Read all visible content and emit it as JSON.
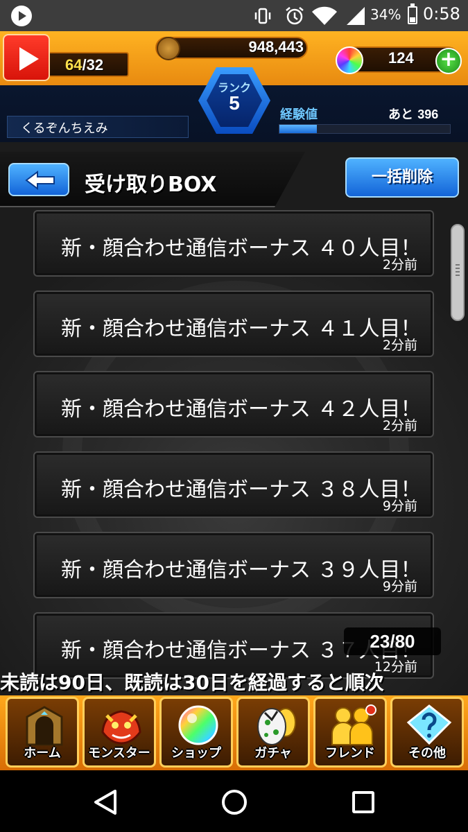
{
  "status_bar": {
    "battery_percent": "34%",
    "battery_level": 0.34,
    "clock": "0:58",
    "icons": [
      "vibrate-icon",
      "alarm-icon",
      "wifi-icon",
      "signal-icon",
      "battery-icon"
    ]
  },
  "header": {
    "stamina_current": "64",
    "stamina_max": "/32",
    "gold": "948,443",
    "orbs": "124",
    "rank_label": "ランク",
    "rank_value": "5",
    "player_name": "くるぞんちえみ",
    "exp_label": "経験値",
    "exp_remaining_prefix": "あと",
    "exp_remaining_value": "396",
    "exp_progress": 0.22
  },
  "page": {
    "title": "受け取りBOX",
    "delete_all_label": "一括削除",
    "page_counter": "23/80",
    "notice": "未読は90日、既読は30日を経過すると順次"
  },
  "messages": [
    {
      "title": "新・顔合わせ通信ボーナス ４０人目！",
      "time": "2分前"
    },
    {
      "title": "新・顔合わせ通信ボーナス ４１人目！",
      "time": "2分前"
    },
    {
      "title": "新・顔合わせ通信ボーナス ４２人目！",
      "time": "2分前"
    },
    {
      "title": "新・顔合わせ通信ボーナス ３８人目！",
      "time": "9分前"
    },
    {
      "title": "新・顔合わせ通信ボーナス ３９人目！",
      "time": "9分前"
    },
    {
      "title": "新・顔合わせ通信ボーナス ３７人目！",
      "time": "12分前"
    }
  ],
  "bottom_nav": [
    {
      "label": "ホーム",
      "icon": "gate-icon"
    },
    {
      "label": "モンスター",
      "icon": "dragon-icon"
    },
    {
      "label": "ショップ",
      "icon": "orb-icon"
    },
    {
      "label": "ガチャ",
      "icon": "egg-icon"
    },
    {
      "label": "フレンド",
      "icon": "friends-icon"
    },
    {
      "label": "その他",
      "icon": "question-icon"
    }
  ],
  "colors": {
    "accent_orange": "#ffa81c",
    "accent_blue": "#1364d8"
  }
}
